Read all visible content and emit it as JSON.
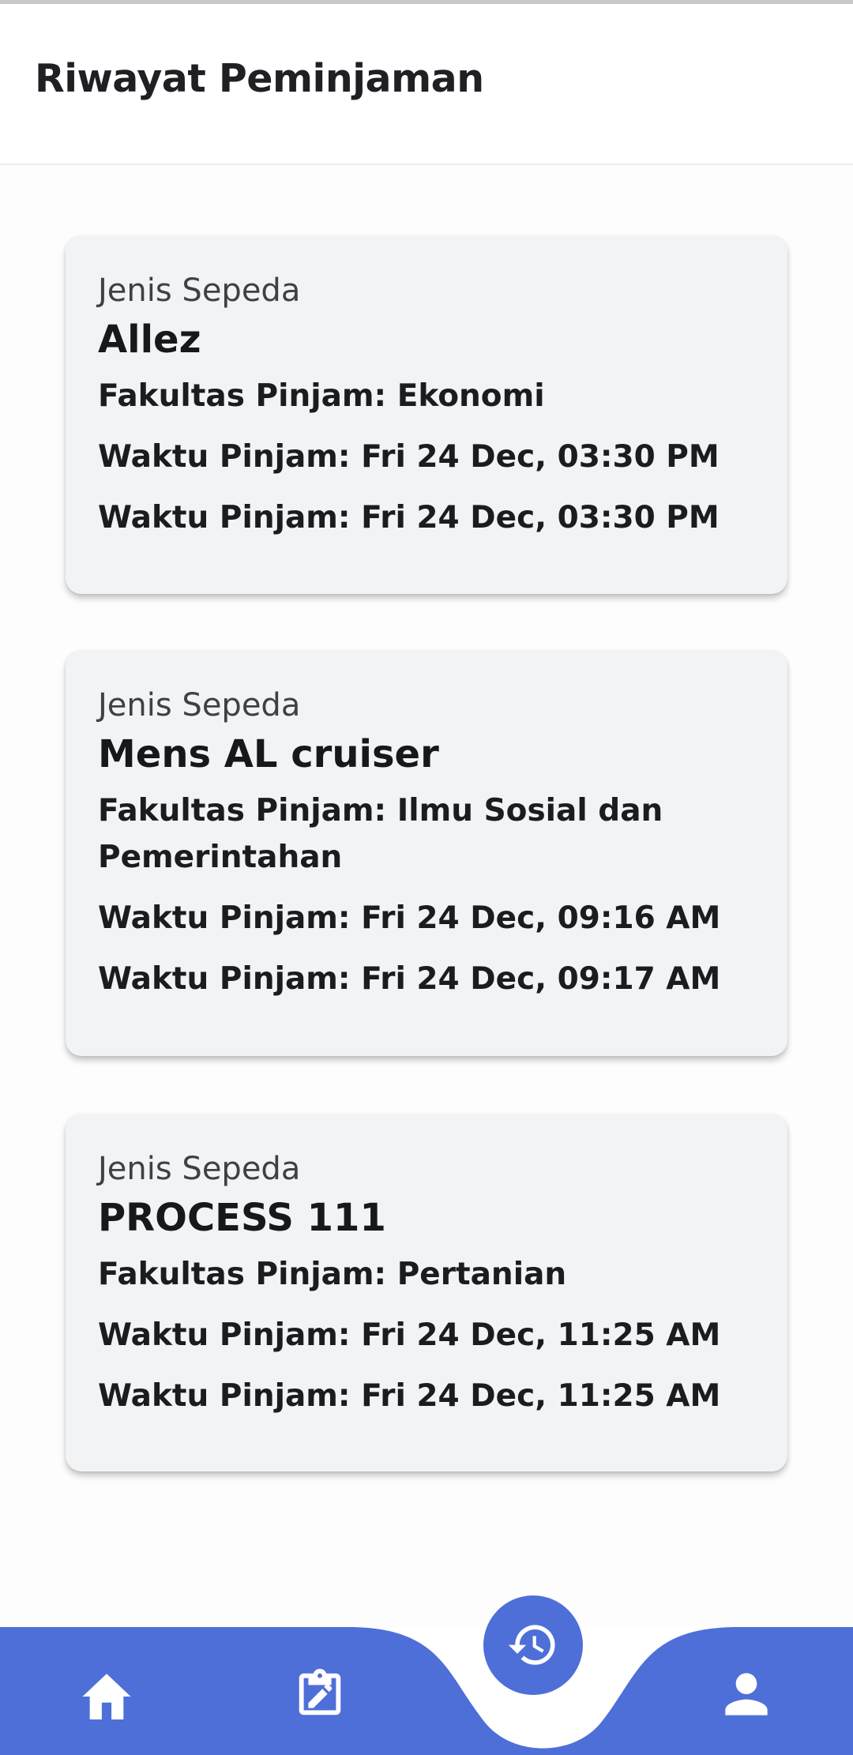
{
  "header": {
    "title": "Riwayat Peminjaman"
  },
  "history": [
    {
      "caption": "Jenis Sepeda",
      "bike_name": "Allez",
      "faculty_line": "Fakultas Pinjam: Ekonomi",
      "time_line_1": "Waktu Pinjam: Fri 24 Dec, 03:30 PM",
      "time_line_2": "Waktu Pinjam: Fri 24 Dec, 03:30 PM"
    },
    {
      "caption": "Jenis Sepeda",
      "bike_name": "Mens AL cruiser",
      "faculty_line": "Fakultas Pinjam: Ilmu Sosial dan Pemerintahan",
      "time_line_1": "Waktu Pinjam: Fri 24 Dec, 09:16 AM",
      "time_line_2": "Waktu Pinjam: Fri 24 Dec, 09:17 AM"
    },
    {
      "caption": "Jenis Sepeda",
      "bike_name": "PROCESS 111",
      "faculty_line": "Fakultas Pinjam: Pertanian",
      "time_line_1": "Waktu Pinjam: Fri 24 Dec, 11:25 AM",
      "time_line_2": "Waktu Pinjam: Fri 24 Dec, 11:25 AM"
    }
  ],
  "bottom_nav": {
    "items": [
      {
        "icon": "home-icon"
      },
      {
        "icon": "edit-clipboard-icon"
      },
      {
        "icon": "history-icon",
        "active": true
      },
      {
        "icon": "profile-icon"
      }
    ]
  },
  "colors": {
    "accent": "#4e6fd8",
    "card_background": "#f2f3f5",
    "text": "#1b1c20",
    "icon": "#ffffff"
  }
}
